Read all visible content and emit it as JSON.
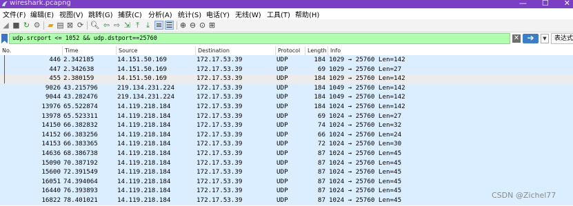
{
  "window": {
    "title": "wireshark.pcapng",
    "controls": [
      "—",
      "☐",
      "✕"
    ]
  },
  "menu": [
    "文件(F)",
    "编辑(E)",
    "视图(V)",
    "跳转(G)",
    "捕获(C)",
    "分析(A)",
    "统计(S)",
    "电话(Y)",
    "无线(W)",
    "工具(T)",
    "帮助(H)"
  ],
  "toolbar": {
    "icons": [
      "start-capture",
      "stop-capture",
      "restart-capture",
      "capture-options",
      "open-file",
      "save-file",
      "close-file",
      "reload-file",
      "find-packet",
      "go-back",
      "go-forward",
      "go-to-packet",
      "go-first",
      "go-last",
      "autoscroll",
      "colorize",
      "zoom-in",
      "zoom-out",
      "zoom-normal",
      "resize-columns"
    ]
  },
  "filter": {
    "value": "udp.srcport <= 1052 && udp.dstport==25760",
    "expression_label": "表达式…",
    "color": "#afffaf"
  },
  "columns": [
    "No.",
    "Time",
    "Source",
    "Destination",
    "Protocol",
    "Length",
    "Info"
  ],
  "packets": [
    {
      "no": "446",
      "time": "2.342185",
      "src": "14.151.50.169",
      "dst": "172.17.53.39",
      "proto": "UDP",
      "len": "184",
      "info": "1029 → 25760 Len=142"
    },
    {
      "no": "447",
      "time": "2.342638",
      "src": "14.151.50.169",
      "dst": "172.17.53.39",
      "proto": "UDP",
      "len": "69",
      "info": "1029 → 25760 Len=27"
    },
    {
      "no": "455",
      "time": "2.380159",
      "src": "14.151.50.169",
      "dst": "172.17.53.39",
      "proto": "UDP",
      "len": "184",
      "info": "1029 → 25760 Len=142",
      "selected": true
    },
    {
      "no": "9026",
      "time": "43.215796",
      "src": "219.134.231.224",
      "dst": "172.17.53.39",
      "proto": "UDP",
      "len": "184",
      "info": "1049 → 25760 Len=142"
    },
    {
      "no": "9044",
      "time": "43.282476",
      "src": "219.134.231.224",
      "dst": "172.17.53.39",
      "proto": "UDP",
      "len": "184",
      "info": "1049 → 25760 Len=142"
    },
    {
      "no": "13976",
      "time": "65.522874",
      "src": "14.119.218.184",
      "dst": "172.17.53.39",
      "proto": "UDP",
      "len": "184",
      "info": "1024 → 25760 Len=142"
    },
    {
      "no": "13978",
      "time": "65.523311",
      "src": "14.119.218.184",
      "dst": "172.17.53.39",
      "proto": "UDP",
      "len": "69",
      "info": "1024 → 25760 Len=27"
    },
    {
      "no": "14150",
      "time": "66.382832",
      "src": "14.119.218.184",
      "dst": "172.17.53.39",
      "proto": "UDP",
      "len": "74",
      "info": "1024 → 25760 Len=32"
    },
    {
      "no": "14152",
      "time": "66.383256",
      "src": "14.119.218.184",
      "dst": "172.17.53.39",
      "proto": "UDP",
      "len": "66",
      "info": "1024 → 25760 Len=24"
    },
    {
      "no": "14153",
      "time": "66.383365",
      "src": "14.119.218.184",
      "dst": "172.17.53.39",
      "proto": "UDP",
      "len": "72",
      "info": "1024 → 25760 Len=30"
    },
    {
      "no": "14636",
      "time": "68.386738",
      "src": "14.119.218.184",
      "dst": "172.17.53.39",
      "proto": "UDP",
      "len": "87",
      "info": "1024 → 25760 Len=45"
    },
    {
      "no": "15090",
      "time": "70.387192",
      "src": "14.119.218.184",
      "dst": "172.17.53.39",
      "proto": "UDP",
      "len": "87",
      "info": "1024 → 25760 Len=45"
    },
    {
      "no": "15600",
      "time": "72.391549",
      "src": "14.119.218.184",
      "dst": "172.17.53.39",
      "proto": "UDP",
      "len": "87",
      "info": "1024 → 25760 Len=45"
    },
    {
      "no": "16051",
      "time": "74.394064",
      "src": "14.119.218.184",
      "dst": "172.17.53.39",
      "proto": "UDP",
      "len": "87",
      "info": "1024 → 25760 Len=45"
    },
    {
      "no": "16440",
      "time": "76.393893",
      "src": "14.119.218.184",
      "dst": "172.17.53.39",
      "proto": "UDP",
      "len": "87",
      "info": "1024 → 25760 Len=45"
    },
    {
      "no": "16822",
      "time": "78.401021",
      "src": "14.119.218.184",
      "dst": "172.17.53.39",
      "proto": "UDP",
      "len": "87",
      "info": "1024 → 25760 Len=45"
    }
  ],
  "watermark": "CSDN @Zichel77",
  "colors": {
    "title_bar": "#7a3fc4",
    "row_bg": "#daeeff",
    "selected_row_bg": "#ececec"
  }
}
